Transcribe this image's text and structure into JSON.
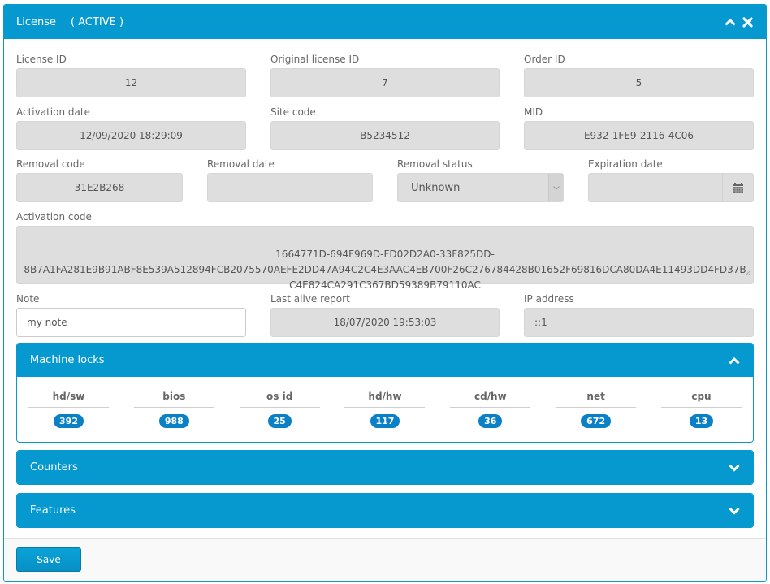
{
  "header": {
    "title": "License",
    "status": "( ACTIVE )"
  },
  "fields": {
    "license_id": {
      "label": "License ID",
      "value": "12"
    },
    "original_license_id": {
      "label": "Original license ID",
      "value": "7"
    },
    "order_id": {
      "label": "Order ID",
      "value": "5"
    },
    "activation_date": {
      "label": "Activation date",
      "value": "12/09/2020 18:29:09"
    },
    "site_code": {
      "label": "Site code",
      "value": "B5234512"
    },
    "mid": {
      "label": "MID",
      "value": "E932-1FE9-2116-4C06"
    },
    "removal_code": {
      "label": "Removal code",
      "value": "31E2B268"
    },
    "removal_date": {
      "label": "Removal date",
      "value": "-"
    },
    "removal_status": {
      "label": "Removal status",
      "value": "Unknown"
    },
    "expiration_date": {
      "label": "Expiration date",
      "value": ""
    },
    "activation_code": {
      "label": "Activation code",
      "value": "1664771D-694F969D-FD02D2A0-33F825DD-\n8B7A1FA281E9B91ABF8E539A512894FCB2075570AEFE2DD47A94C2C4E3AAC4EB700F26C276784428B01652F69816DCA80DA4E11493DD4FD37B\nC4E824CA291C367BD59389B79110AC"
    },
    "note": {
      "label": "Note",
      "value": "my note"
    },
    "last_alive_report": {
      "label": "Last alive report",
      "value": "18/07/2020 19:53:03"
    },
    "ip_address": {
      "label": "IP address",
      "value": "::1"
    }
  },
  "machine_locks": {
    "title": "Machine locks",
    "items": [
      {
        "name": "hd/sw",
        "value": "392"
      },
      {
        "name": "bios",
        "value": "988"
      },
      {
        "name": "os id",
        "value": "25"
      },
      {
        "name": "hd/hw",
        "value": "117"
      },
      {
        "name": "cd/hw",
        "value": "36"
      },
      {
        "name": "net",
        "value": "672"
      },
      {
        "name": "cpu",
        "value": "13"
      }
    ]
  },
  "counters": {
    "title": "Counters"
  },
  "features": {
    "title": "Features"
  },
  "footer": {
    "save_label": "Save"
  },
  "colors": {
    "accent": "#0599cf",
    "badge": "#0a81c6",
    "readonly_bg": "#dedede"
  }
}
